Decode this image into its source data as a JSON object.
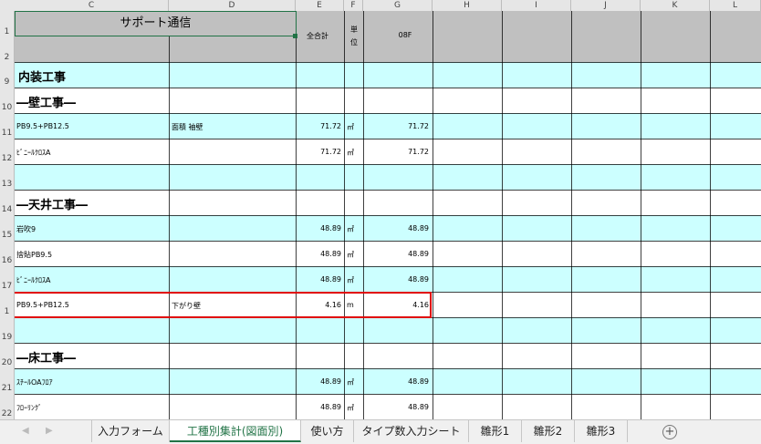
{
  "columns": [
    "C",
    "D",
    "E",
    "F",
    "G",
    "H",
    "I",
    "J",
    "K",
    "L"
  ],
  "header": {
    "title": "サポート通信",
    "e_label": "全合計",
    "f_label": "単\n位",
    "g_label": "08F"
  },
  "row_numbers": [
    "1",
    "2",
    "9",
    "10",
    "11",
    "12",
    "13",
    "14",
    "15",
    "16",
    "17",
    "1",
    "19",
    "20",
    "21",
    "22"
  ],
  "rows": [
    {
      "c": "内装工事",
      "d": "",
      "e": "",
      "f": "",
      "g": "",
      "section": true
    },
    {
      "c": "―壁工事―",
      "d": "",
      "e": "",
      "f": "",
      "g": "",
      "section": true
    },
    {
      "c": "PB9.5+PB12.5",
      "d": "面積 袖壁",
      "e": "71.72",
      "f": "㎡",
      "g": "71.72"
    },
    {
      "c": "ﾋﾞﾆｰﾙｸﾛｽA",
      "d": "",
      "e": "71.72",
      "f": "㎡",
      "g": "71.72"
    },
    {
      "c": "",
      "d": "",
      "e": "",
      "f": "",
      "g": ""
    },
    {
      "c": "―天井工事―",
      "d": "",
      "e": "",
      "f": "",
      "g": "",
      "section": true
    },
    {
      "c": "岩吹9",
      "d": "",
      "e": "48.89",
      "f": "㎡",
      "g": "48.89"
    },
    {
      "c": "捨貼PB9.5",
      "d": "",
      "e": "48.89",
      "f": "㎡",
      "g": "48.89"
    },
    {
      "c": "ﾋﾞﾆｰﾙｸﾛｽA",
      "d": "",
      "e": "48.89",
      "f": "㎡",
      "g": "48.89"
    },
    {
      "c": "PB9.5+PB12.5",
      "d": "下がり壁",
      "e": "4.16",
      "f": "m",
      "g": "4.16"
    },
    {
      "c": "",
      "d": "",
      "e": "",
      "f": "",
      "g": ""
    },
    {
      "c": "―床工事―",
      "d": "",
      "e": "",
      "f": "",
      "g": "",
      "section": true
    },
    {
      "c": "ｽﾁｰﾙOAﾌﾛｱ",
      "d": "",
      "e": "48.89",
      "f": "㎡",
      "g": "48.89"
    },
    {
      "c": "ﾌﾛｰﾘﾝｸﾞ",
      "d": "",
      "e": "48.89",
      "f": "㎡",
      "g": "48.89"
    }
  ],
  "tabs": [
    "入力フォーム",
    "工種別集計(図面別)",
    "使い方",
    "タイプ数入力シート",
    "雛形1",
    "雛形2",
    "雛形3"
  ],
  "active_tab": "工種別集計(図面別)",
  "colors": {
    "accent": "#217346",
    "highlight": "#e00000",
    "band": "#ccffff"
  }
}
